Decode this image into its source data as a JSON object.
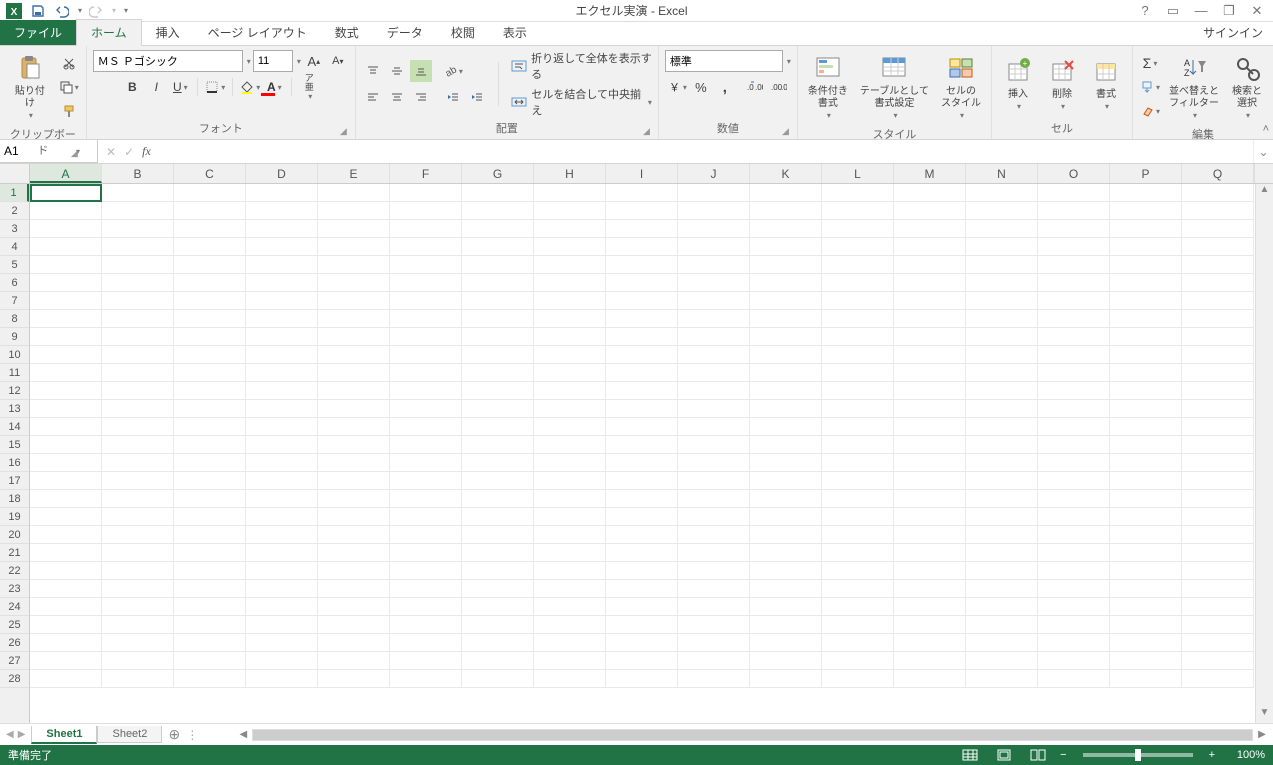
{
  "titlebar": {
    "title": "エクセル実演 - Excel"
  },
  "tabs": {
    "file": "ファイル",
    "items": [
      "ホーム",
      "挿入",
      "ページ レイアウト",
      "数式",
      "データ",
      "校閲",
      "表示"
    ],
    "active": 0,
    "signin": "サインイン"
  },
  "ribbon": {
    "clipboard": {
      "label": "クリップボード",
      "paste": "貼り付け"
    },
    "font": {
      "label": "フォント",
      "name": "ＭＳ Ｐゴシック",
      "size": "11"
    },
    "alignment": {
      "label": "配置",
      "wrap": "折り返して全体を表示する",
      "merge": "セルを結合して中央揃え"
    },
    "number": {
      "label": "数値",
      "format": "標準"
    },
    "styles": {
      "label": "スタイル",
      "cond": "条件付き\n書式",
      "tbl": "テーブルとして\n書式設定",
      "cell": "セルの\nスタイル"
    },
    "cells": {
      "label": "セル",
      "insert": "挿入",
      "delete": "削除",
      "format": "書式"
    },
    "editing": {
      "label": "編集",
      "sort": "並べ替えと\nフィルター",
      "find": "検索と\n選択"
    }
  },
  "formula": {
    "cellref": "A1",
    "value": ""
  },
  "grid": {
    "cols": [
      "A",
      "B",
      "C",
      "D",
      "E",
      "F",
      "G",
      "H",
      "I",
      "J",
      "K",
      "L",
      "M",
      "N",
      "O",
      "P",
      "Q"
    ],
    "rows": 28,
    "activeCell": "A1"
  },
  "sheets": {
    "tabs": [
      "Sheet1",
      "Sheet2"
    ],
    "active": 0
  },
  "status": {
    "ready": "準備完了",
    "zoom": "100%"
  }
}
